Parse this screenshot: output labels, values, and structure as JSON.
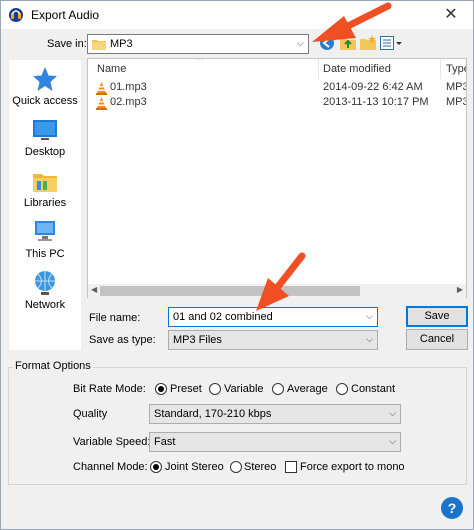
{
  "window": {
    "title": "Export Audio",
    "close_glyph": "✕"
  },
  "save_in": {
    "label": "Save in:",
    "value": "MP3"
  },
  "places": [
    {
      "label": "Quick access",
      "icon": "star-icon"
    },
    {
      "label": "Desktop",
      "icon": "desktop-icon"
    },
    {
      "label": "Libraries",
      "icon": "libraries-icon"
    },
    {
      "label": "This PC",
      "icon": "computer-icon"
    },
    {
      "label": "Network",
      "icon": "network-icon"
    }
  ],
  "file_list": {
    "columns": [
      "Name",
      "Date modified",
      "Type"
    ],
    "rows": [
      {
        "name": "01.mp3",
        "date": "2014-09-22 6:42 AM",
        "type": "MP3"
      },
      {
        "name": "02.mp3",
        "date": "2013-11-13 10:17 PM",
        "type": "MP3"
      }
    ]
  },
  "file_name": {
    "label": "File name:",
    "value": "01 and 02 combined"
  },
  "save_as_type": {
    "label": "Save as type:",
    "value": "MP3 Files"
  },
  "buttons": {
    "save": "Save",
    "cancel": "Cancel"
  },
  "format_options": {
    "title": "Format Options",
    "bit_rate_mode": {
      "label": "Bit Rate Mode:",
      "options": [
        "Preset",
        "Variable",
        "Average",
        "Constant"
      ],
      "selected": "Preset"
    },
    "quality": {
      "label": "Quality",
      "value": "Standard, 170-210 kbps"
    },
    "variable_speed": {
      "label": "Variable Speed:",
      "value": "Fast"
    },
    "channel_mode": {
      "label": "Channel Mode:",
      "options": [
        "Joint Stereo",
        "Stereo"
      ],
      "selected": "Joint Stereo",
      "force_mono_label": "Force export to mono",
      "force_mono": false
    }
  },
  "help_glyph": "?",
  "colors": {
    "accent": "#0078d7",
    "annotation_arrow": "#f04e23",
    "help": "#1a74c9"
  }
}
